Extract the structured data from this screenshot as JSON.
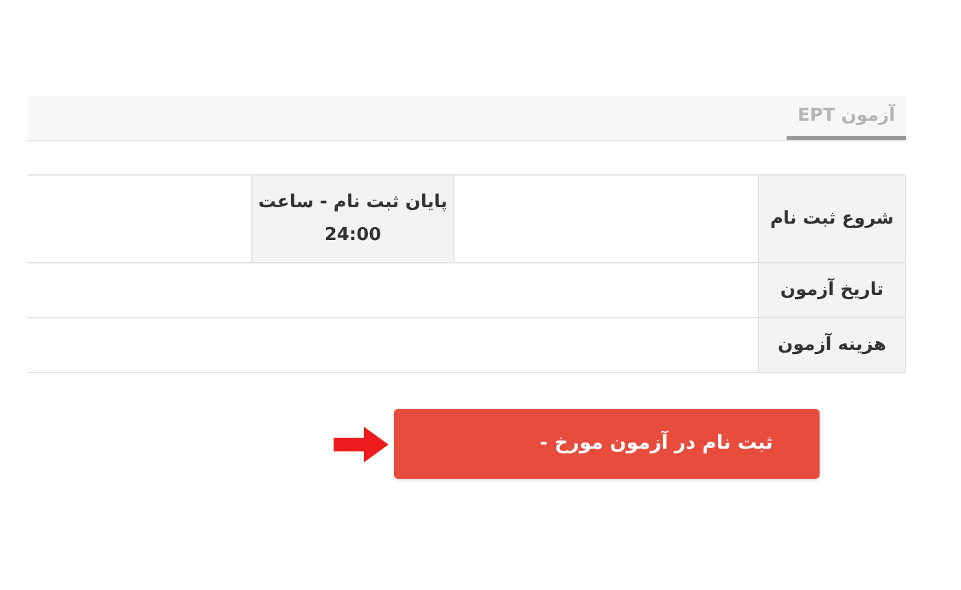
{
  "tabs": [
    {
      "label": "آزمون EPT",
      "selected": true
    }
  ],
  "table": {
    "rows": [
      {
        "kind": "split",
        "label": "شروع ثبت نام",
        "end_registration": {
          "label": "پایان ثبت نام - ساعت",
          "value": "24:00"
        }
      },
      {
        "kind": "wide",
        "label": "تاریخ آزمون"
      },
      {
        "kind": "wide",
        "label": "هزینه آزمون"
      }
    ]
  },
  "register_button": {
    "label": "ثبت نام در آزمون مورخ -"
  }
}
